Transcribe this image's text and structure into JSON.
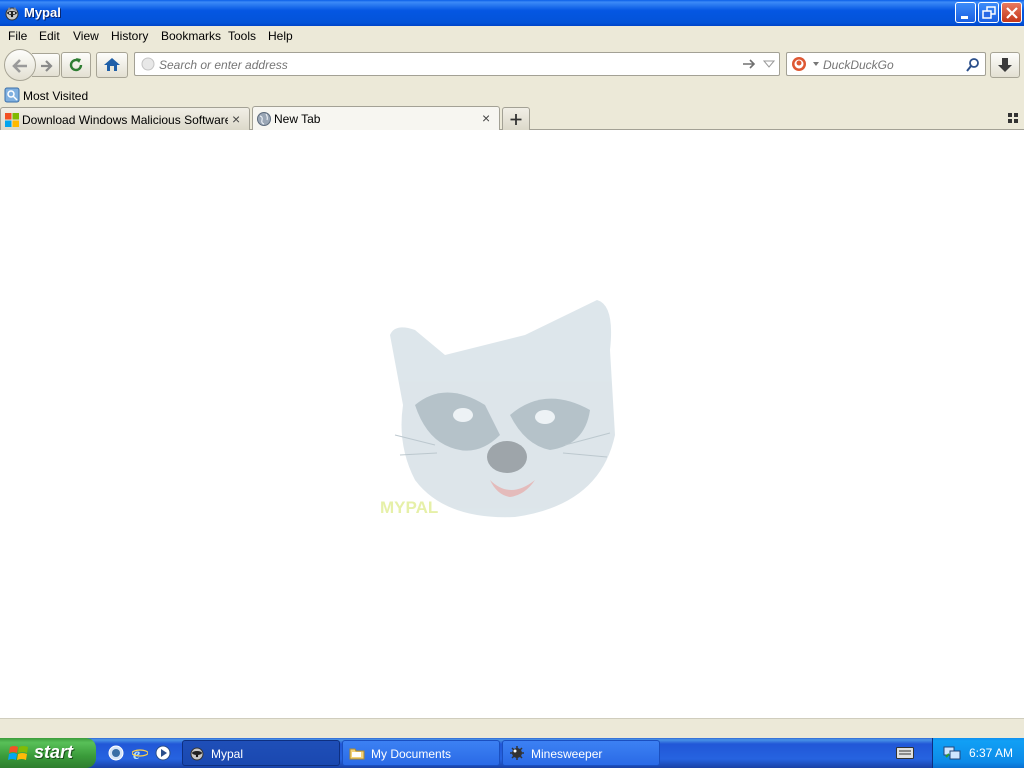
{
  "window": {
    "title": "Mypal"
  },
  "menu": [
    {
      "label": "File"
    },
    {
      "label": "Edit"
    },
    {
      "label": "View"
    },
    {
      "label": "History"
    },
    {
      "label": "Bookmarks"
    },
    {
      "label": "Tools"
    },
    {
      "label": "Help"
    }
  ],
  "nav": {
    "url_placeholder": "Search or enter address",
    "search_placeholder": "DuckDuckGo"
  },
  "bookmarks": {
    "most_visited": "Most Visited"
  },
  "tabs": [
    {
      "label": "Download Windows Malicious Software R...",
      "active": false
    },
    {
      "label": "New Tab",
      "active": true
    }
  ],
  "content": {
    "logo_caption": "MYPAL"
  },
  "taskbar": {
    "start": "start",
    "tasks": [
      {
        "label": "Mypal",
        "active": true
      },
      {
        "label": "My Documents",
        "active": false
      },
      {
        "label": "Minesweeper",
        "active": false
      }
    ],
    "clock": "6:37 AM"
  },
  "colors": {
    "titlebar": "#0557e3",
    "taskbar": "#2663e0",
    "start": "#3a9b3a",
    "chrome": "#ece9d8"
  }
}
